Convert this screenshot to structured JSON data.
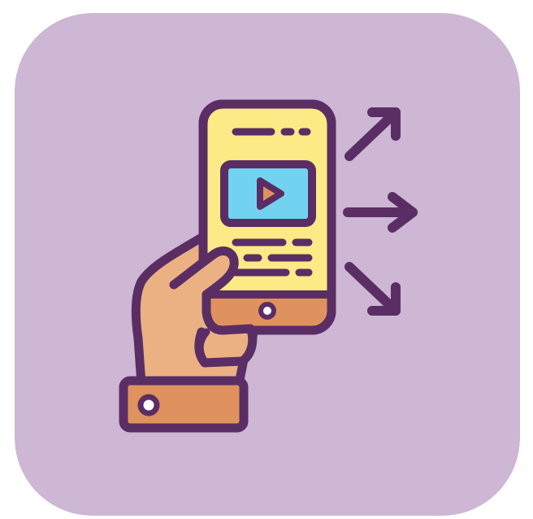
{
  "icon": {
    "name": "share-video-icon",
    "depicts": [
      "hand-icon",
      "smartphone-icon",
      "play-icon",
      "share-arrows-icon"
    ]
  },
  "colors": {
    "background": "#CDB7D4",
    "outline": "#5A2E64",
    "screen": "#FBEA86",
    "video": "#72D3F0",
    "skin": "#ECB183",
    "cuff": "#E0925E",
    "phone_bottom": "#E0925E"
  }
}
